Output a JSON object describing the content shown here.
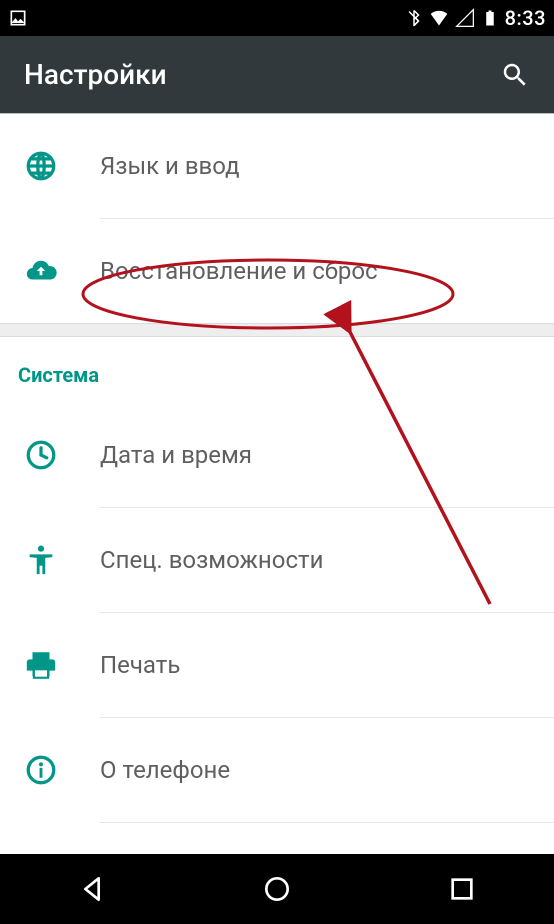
{
  "status": {
    "time": "8:33",
    "icons": {
      "image": "image-icon",
      "bluetooth": "bluetooth-icon",
      "wifi": "wifi-icon",
      "cell": "cell-signal-icon",
      "battery": "battery-icon"
    }
  },
  "appbar": {
    "title": "Настройки",
    "search_icon": "search-icon"
  },
  "rows": {
    "language": {
      "label": "Язык и ввод",
      "icon": "globe-icon"
    },
    "reset": {
      "label": "Восстановление и сброс",
      "icon": "cloud-upload-icon"
    },
    "datetime": {
      "label": "Дата и время",
      "icon": "clock-icon"
    },
    "accessibility": {
      "label": "Спец. возможности",
      "icon": "accessibility-icon"
    },
    "print": {
      "label": "Печать",
      "icon": "printer-icon"
    },
    "about": {
      "label": "О телефоне",
      "icon": "info-icon"
    }
  },
  "section": {
    "system": "Система"
  },
  "colors": {
    "accent": "#009688",
    "appbar_bg": "#31393c",
    "text_secondary": "#5f5f5f",
    "annotation": "#b3111c"
  },
  "navbar": {
    "back": "back-icon",
    "home": "home-icon",
    "recent": "recent-apps-icon"
  }
}
